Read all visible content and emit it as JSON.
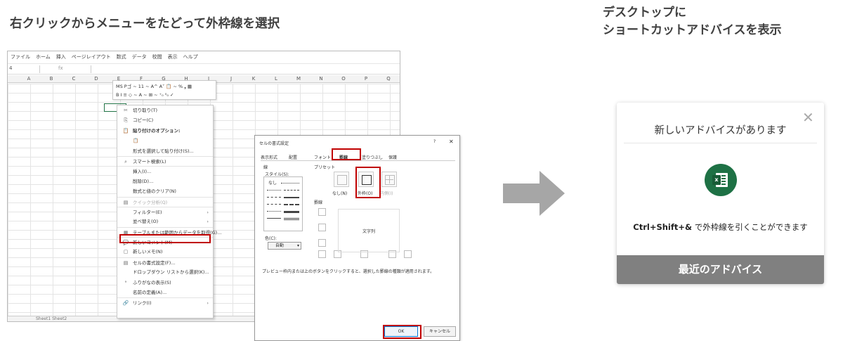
{
  "left_title": "右クリックからメニューをたどって外枠線を選択",
  "right_title_line1": "デスクトップに",
  "right_title_line2": "ショートカットアドバイスを表示",
  "excel": {
    "ribbon_tabs": [
      "ファイル",
      "ホーム",
      "挿入",
      "ページレイアウト",
      "数式",
      "データ",
      "校閲",
      "表示",
      "ヘルプ"
    ],
    "name_box": "4",
    "fx_label": "fx",
    "columns": [
      "A",
      "B",
      "C",
      "D",
      "E",
      "F",
      "G",
      "H",
      "I",
      "J",
      "K",
      "L",
      "M",
      "N",
      "O",
      "P",
      "Q"
    ],
    "sheet_tabs": "Sheet1   Sheet2",
    "mini_toolbar_row1": "MS Pゴ ~ 11  ~ A^ A˅ 📋 ~ % ❟ ▦",
    "mini_toolbar_row2": "B  I  ≡  ◇ ~ A ~ ⊞ ~ ⁺₀ ⁰₀ ✓",
    "context_menu": [
      {
        "icon": "✂",
        "label": "切り取り(T)"
      },
      {
        "icon": "⎘",
        "label": "コピー(C)"
      },
      {
        "icon": "📋",
        "label": "貼り付けのオプション:",
        "bold": true
      },
      {
        "icon": "",
        "label": "📋"
      },
      {
        "icon": "",
        "label": "形式を選択して貼り付け(S)..."
      },
      {
        "icon": "⌕",
        "label": "スマート検索(L)",
        "sep": true
      },
      {
        "icon": "",
        "label": "挿入(I)...",
        "sep": true
      },
      {
        "icon": "",
        "label": "削除(D)..."
      },
      {
        "icon": "",
        "label": "数式と値のクリア(N)"
      },
      {
        "icon": "▤",
        "label": "クイック分析(Q)",
        "dim": true,
        "sep": true
      },
      {
        "icon": "",
        "label": "フィルター(E)",
        "arrow": "›",
        "sep": true
      },
      {
        "icon": "",
        "label": "並べ替え(O)",
        "arrow": "›"
      },
      {
        "icon": "▦",
        "label": "テーブルまたは範囲からデータを取得(G)...",
        "sep": true
      },
      {
        "icon": "💬",
        "label": "新しいコメント(M)",
        "sep": true
      },
      {
        "icon": "▢",
        "label": "新しいメモ(N)"
      },
      {
        "icon": "▤",
        "label": "セルの書式設定(F)...",
        "sep": true
      },
      {
        "icon": "",
        "label": "ドロップダウン リストから選択(K)..."
      },
      {
        "icon": "ᵃ",
        "label": "ふりがなの表示(S)"
      },
      {
        "icon": "",
        "label": "名前の定義(A)..."
      },
      {
        "icon": "🔗",
        "label": "リンク(I)",
        "arrow": "›",
        "sep": true
      }
    ]
  },
  "dialog": {
    "title": "セルの書式設定",
    "help": "?",
    "close": "✕",
    "tabs": [
      "表示形式",
      "配置",
      "フォント",
      "罫線",
      "塗りつぶし",
      "保護"
    ],
    "line_group": "線",
    "style_label": "スタイル(S):",
    "style_none": "なし",
    "color_label": "色(C):",
    "color_value": "自動",
    "preset_label": "プリセット",
    "presets": [
      "なし(N)",
      "外枠(O)",
      "内側(I)"
    ],
    "border_label": "罫線",
    "preview_text": "文字列",
    "note": "プレビュー枠内または上のボタンをクリックすると、選択した罫線の種類が適用されます。",
    "ok": "OK",
    "cancel": "キャンセル"
  },
  "card": {
    "title": "新しいアドバイスがあります",
    "close": "✕",
    "shortcut": "Ctrl+Shift+&",
    "message": " で外枠線を引くことができます",
    "footer": "最近のアドバイス",
    "icon_letter": "x"
  },
  "colors": {
    "highlight": "#c00000",
    "excel_green": "#1e7145",
    "arrow_gray": "#a6a6a6",
    "footer_gray": "#808080"
  }
}
